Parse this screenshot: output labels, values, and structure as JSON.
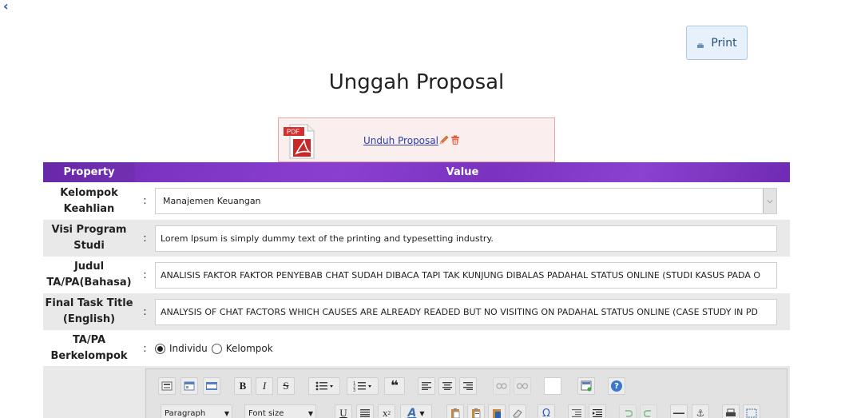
{
  "page": {
    "title": "Unggah Proposal",
    "print_label": "Print",
    "back_icon": "back-arrow-icon"
  },
  "proposal": {
    "link_label": "Unduh Proposal",
    "pdf_icon_text": "PDF",
    "colors": {
      "box_bg": "#fbeeee",
      "box_border": "#e3a7a7",
      "pdf_red": "#d32f2f"
    }
  },
  "table": {
    "header_property": "Property",
    "header_value": "Value",
    "header_color": "#7a32bf",
    "rows": [
      {
        "label_line1": "Kelompok",
        "label_line2": "Keahlian",
        "colon": ":",
        "type": "select",
        "value": "Manajemen Keuangan"
      },
      {
        "label_line1": "Visi Program",
        "label_line2": "Studi",
        "colon": ":",
        "type": "text",
        "value": "Lorem Ipsum is simply dummy text of the printing and typesetting industry."
      },
      {
        "label_line1": "Judul",
        "label_line2": "TA/PA(Bahasa)",
        "colon": ":",
        "type": "text",
        "value": "ANALISIS FAKTOR FAKTOR PENYEBAB CHAT SUDAH DIBACA TAPI TAK KUNJUNG DIBALAS PADAHAL STATUS ONLINE (STUDI KASUS PADA O"
      },
      {
        "label_line1": "Final Task Title",
        "label_line2": "(English)",
        "colon": ":",
        "type": "text",
        "value": "ANALYSIS OF CHAT FACTORS WHICH CAUSES ARE ALREADY READED BUT NO VISITING ON PADAHAL STATUS ONLINE (CASE STUDY IN PD"
      },
      {
        "label_line1": "TA/PA",
        "label_line2": "Berkelompok",
        "colon": ":",
        "type": "radio",
        "options": [
          "Individu",
          "Kelompok"
        ],
        "selected": "Individu"
      }
    ]
  },
  "editor": {
    "format_select": "Paragraph",
    "fontsize_select": "Font size",
    "row1_icons": [
      "source-icon",
      "template-icon",
      "html-icon",
      "bold-icon",
      "italic-icon",
      "strikethrough-icon",
      "bullet-list-icon",
      "numbered-list-icon",
      "blockquote-icon",
      "align-left-icon",
      "align-center-icon",
      "align-right-icon",
      "link-icon",
      "unlink-icon",
      "blank-icon",
      "image-icon",
      "help-icon"
    ],
    "row2_icons": [
      "underline-icon",
      "justify-icon",
      "superscript-icon",
      "text-color-icon",
      "paste-icon",
      "paste-text-icon",
      "paste-word-icon",
      "eraser-icon",
      "omega-icon",
      "outdent-icon",
      "indent-icon",
      "undo-icon",
      "redo-icon",
      "hr-icon",
      "anchor-icon",
      "print-icon",
      "spellcheck-icon"
    ],
    "labels": {
      "bold": "B",
      "italic": "I",
      "strike": "S",
      "quote": "❝",
      "underline": "U",
      "superscript": "x",
      "superscript_sup": "2",
      "textcolor": "A",
      "omega": "Ω",
      "help": "?",
      "anchor": "⚓"
    }
  }
}
